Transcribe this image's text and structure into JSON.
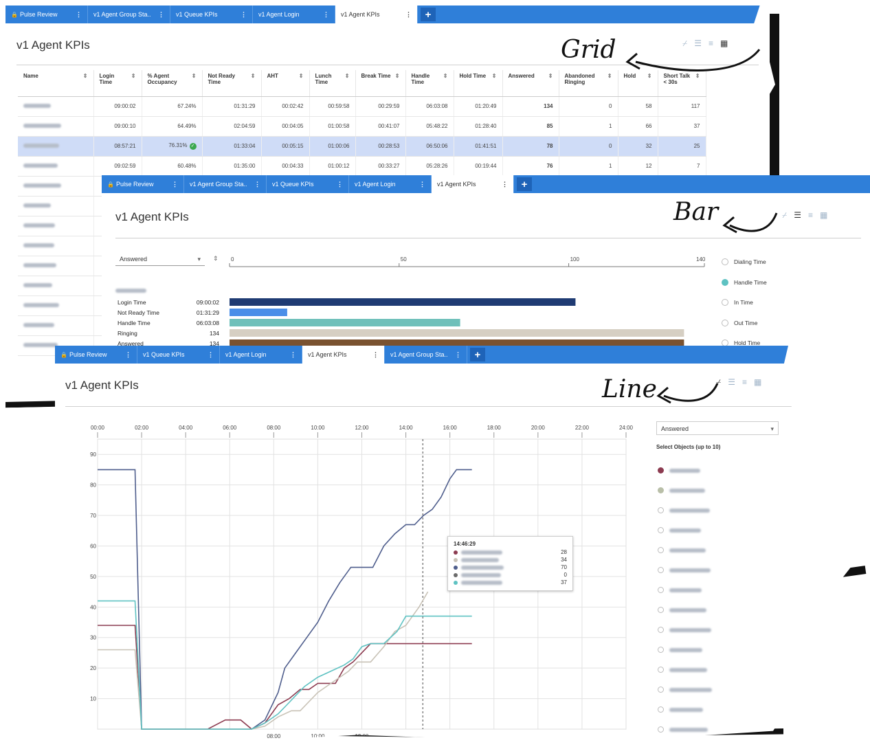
{
  "grid_view": {
    "tabs": [
      {
        "label": "Pulse Review",
        "lock": true
      },
      {
        "label": "v1 Agent Group Sta.."
      },
      {
        "label": "v1 Queue KPIs"
      },
      {
        "label": "v1 Agent Login"
      },
      {
        "label": "v1 Agent KPIs",
        "active": true
      }
    ],
    "title": "v1 Agent KPIs",
    "annotation": "Grid",
    "columns": [
      "Name",
      "Login Time",
      "% Agent Occupancy",
      "Not Ready Time",
      "AHT",
      "Lunch Time",
      "Break Time",
      "Handle Time",
      "Hold Time",
      "Answered",
      "Abandoned Ringing",
      "Hold",
      "Short Talk < 30s"
    ],
    "rows": [
      [
        "09:00:02",
        "67.24%",
        "01:31:29",
        "00:02:42",
        "00:59:58",
        "00:29:59",
        "06:03:08",
        "01:20:49",
        "134",
        "0",
        "58",
        "117"
      ],
      [
        "09:00:10",
        "64.49%",
        "02:04:59",
        "00:04:05",
        "01:00:58",
        "00:41:07",
        "05:48:22",
        "01:28:40",
        "85",
        "1",
        "66",
        "37"
      ],
      [
        "08:57:21",
        "76.31%",
        "01:33:04",
        "00:05:15",
        "01:00:06",
        "00:28:53",
        "06:50:06",
        "01:41:51",
        "78",
        "0",
        "32",
        "25"
      ],
      [
        "09:02:59",
        "60.48%",
        "01:35:00",
        "00:04:33",
        "01:00:12",
        "00:33:27",
        "05:28:26",
        "00:19:44",
        "76",
        "1",
        "12",
        "7"
      ]
    ]
  },
  "bar_view": {
    "tabs": [
      {
        "label": "Pulse Review",
        "lock": true
      },
      {
        "label": "v1 Agent Group Sta.."
      },
      {
        "label": "v1 Queue KPIs"
      },
      {
        "label": "v1 Agent Login"
      },
      {
        "label": "v1 Agent KPIs",
        "active": true
      }
    ],
    "title": "v1 Agent KPIs",
    "annotation": "Bar",
    "metric_select": "Answered",
    "axis_ticks": [
      "0",
      "50",
      "100",
      "140"
    ],
    "bars": [
      {
        "label": "Login Time",
        "value_text": "09:00:02",
        "value": 102,
        "color": "#1f3b73"
      },
      {
        "label": "Not Ready Time",
        "value_text": "01:31:29",
        "value": 17,
        "color": "#4a8ee8"
      },
      {
        "label": "Handle Time",
        "value_text": "06:03:08",
        "value": 68,
        "color": "#6fc0ba"
      },
      {
        "label": "Ringing",
        "value_text": "134",
        "value": 134,
        "color": "#d6cfc3"
      },
      {
        "label": "Answered",
        "value_text": "134",
        "value": 134,
        "color": "#7a5230"
      }
    ],
    "legend": [
      {
        "label": "Dialing Time",
        "on": false
      },
      {
        "label": "Handle Time",
        "on": true
      },
      {
        "label": "In Time",
        "on": false
      },
      {
        "label": "Out Time",
        "on": false
      },
      {
        "label": "Hold Time",
        "on": false
      }
    ]
  },
  "line_view": {
    "tabs": [
      {
        "label": "Pulse Review",
        "lock": true
      },
      {
        "label": "v1 Queue KPIs"
      },
      {
        "label": "v1 Agent Login"
      },
      {
        "label": "v1 Agent KPIs",
        "active": true
      },
      {
        "label": "v1 Agent Group Sta.."
      }
    ],
    "title": "v1 Agent KPIs",
    "annotation": "Line",
    "metric_select": "Answered",
    "select_objects_label": "Select Objects (up to 10)",
    "tooltip": {
      "time": "14:46:29",
      "values": [
        "28",
        "34",
        "70",
        "0",
        "37"
      ]
    },
    "bottom_ticks": [
      "08:00",
      "10:00",
      "12:00"
    ]
  },
  "chart_data": {
    "type": "line",
    "x_ticks": [
      "00:00",
      "02:00",
      "04:00",
      "06:00",
      "08:00",
      "10:00",
      "12:00",
      "14:00",
      "16:00",
      "18:00",
      "20:00",
      "22:00",
      "24:00"
    ],
    "ylim": [
      0,
      95
    ],
    "y_ticks": [
      10,
      20,
      30,
      40,
      50,
      60,
      70,
      80,
      90
    ],
    "cursor_x": 14.77,
    "grid": true,
    "series": [
      {
        "color": "#4e5d8c",
        "points": [
          [
            0,
            85
          ],
          [
            1.7,
            85
          ],
          [
            2,
            0
          ],
          [
            7,
            0
          ],
          [
            7.6,
            3
          ],
          [
            8.2,
            12
          ],
          [
            8.5,
            20
          ],
          [
            9,
            25
          ],
          [
            9.5,
            30
          ],
          [
            10,
            35
          ],
          [
            10.5,
            42
          ],
          [
            11,
            48
          ],
          [
            11.5,
            53
          ],
          [
            12.5,
            53
          ],
          [
            13,
            60
          ],
          [
            13.5,
            64
          ],
          [
            14,
            67
          ],
          [
            14.4,
            67
          ],
          [
            14.8,
            70
          ],
          [
            15.2,
            72
          ],
          [
            15.6,
            76
          ],
          [
            16,
            82
          ],
          [
            16.3,
            85
          ],
          [
            17,
            85
          ]
        ]
      },
      {
        "color": "#8c3b50",
        "points": [
          [
            0,
            34
          ],
          [
            1.7,
            34
          ],
          [
            2,
            0
          ],
          [
            5,
            0
          ],
          [
            5.8,
            3
          ],
          [
            6.5,
            3
          ],
          [
            7,
            0
          ],
          [
            7.6,
            2
          ],
          [
            8.2,
            8
          ],
          [
            8.7,
            10
          ],
          [
            9.2,
            13
          ],
          [
            9.6,
            13
          ],
          [
            10,
            15
          ],
          [
            10.8,
            15
          ],
          [
            11.2,
            20
          ],
          [
            11.6,
            22
          ],
          [
            12,
            25
          ],
          [
            12.4,
            28
          ],
          [
            17,
            28
          ]
        ]
      },
      {
        "color": "#c8c2b6",
        "points": [
          [
            0,
            26
          ],
          [
            1.7,
            26
          ],
          [
            2,
            0
          ],
          [
            7,
            0
          ],
          [
            7.6,
            1
          ],
          [
            8.2,
            4
          ],
          [
            8.8,
            6
          ],
          [
            9.2,
            6
          ],
          [
            9.6,
            9
          ],
          [
            10,
            12
          ],
          [
            10.6,
            15
          ],
          [
            11,
            17
          ],
          [
            11.4,
            19
          ],
          [
            11.8,
            22
          ],
          [
            12.4,
            22
          ],
          [
            13,
            27
          ],
          [
            13.5,
            32
          ],
          [
            14,
            34
          ],
          [
            14.6,
            40
          ],
          [
            15,
            45
          ]
        ]
      },
      {
        "color": "#5ec2c2",
        "points": [
          [
            0,
            42
          ],
          [
            1.7,
            42
          ],
          [
            2,
            0
          ],
          [
            7,
            0
          ],
          [
            7.6,
            2
          ],
          [
            8.2,
            5
          ],
          [
            8.6,
            8
          ],
          [
            9,
            11
          ],
          [
            9.4,
            14
          ],
          [
            10,
            17
          ],
          [
            10.6,
            19
          ],
          [
            11.2,
            21
          ],
          [
            11.6,
            23
          ],
          [
            12,
            27
          ],
          [
            12.4,
            28
          ],
          [
            13,
            28
          ],
          [
            13.6,
            32
          ],
          [
            14,
            37
          ],
          [
            17,
            37
          ]
        ]
      }
    ]
  }
}
